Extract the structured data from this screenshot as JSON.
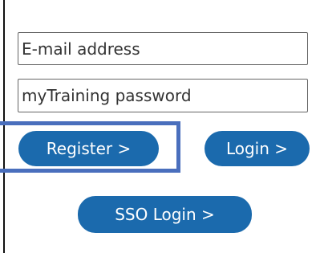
{
  "form": {
    "email_placeholder": "E-mail address",
    "password_placeholder": "myTraining password"
  },
  "buttons": {
    "register_label": "Register >",
    "login_label": "Login >",
    "sso_label": "SSO Login >"
  },
  "colors": {
    "button_bg": "#1b6aad",
    "highlight_border": "#4a6fbd"
  }
}
